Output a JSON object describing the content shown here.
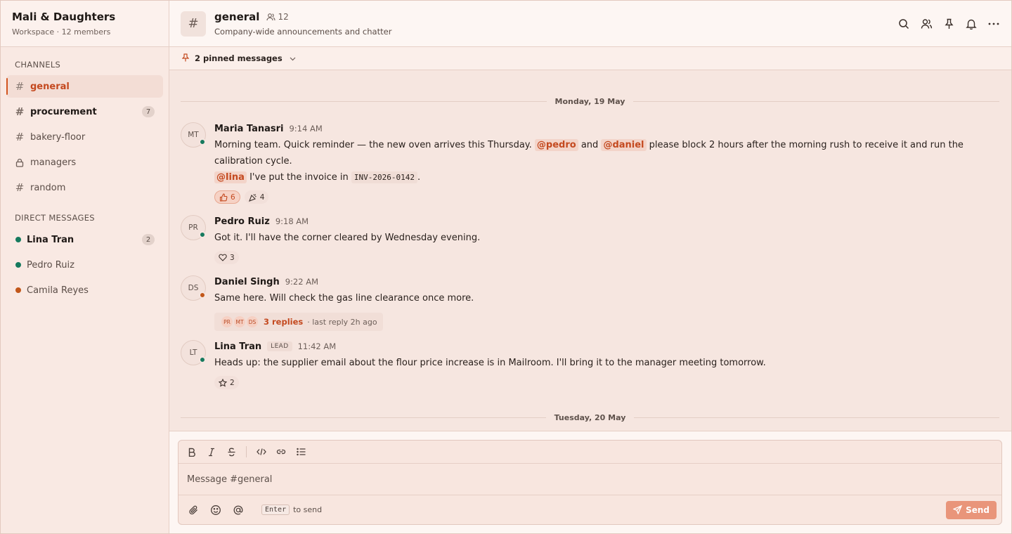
{
  "workspace": {
    "name": "Mali & Daughters",
    "subtitle": "Workspace · 12 members"
  },
  "sidebar": {
    "channels_title": "CHANNELS",
    "channels": [
      {
        "name": "general",
        "badge": ""
      },
      {
        "name": "procurement",
        "badge": "7"
      },
      {
        "name": "bakery-floor",
        "badge": ""
      },
      {
        "name": "managers",
        "badge": ""
      },
      {
        "name": "random",
        "badge": ""
      }
    ],
    "dms_title": "DIRECT MESSAGES",
    "dms": [
      {
        "name": "Lina Tran",
        "badge": "2",
        "status_color": "#167a5e"
      },
      {
        "name": "Pedro Ruiz",
        "badge": "",
        "status_color": "#167a5e"
      },
      {
        "name": "Camila Reyes",
        "badge": "",
        "status_color": "#c2571a"
      }
    ]
  },
  "header": {
    "channel_icon": "#",
    "title": "general",
    "member_count": "12",
    "description": "Company-wide announcements and chatter"
  },
  "pinned": {
    "label": "2 pinned messages"
  },
  "days": [
    {
      "label": "Monday, 19 May"
    },
    {
      "label": "Tuesday, 20 May"
    }
  ],
  "messages": [
    {
      "initials": "MT",
      "author": "Maria Tanasri",
      "time": "9:14 AM",
      "status_color": "#167a5e",
      "text": {
        "p1": "Morning team. Quick reminder — the new oven arrives this Thursday.",
        "m1": "@pedro",
        "p2": "and",
        "m2": "@daniel",
        "p3": "please block 2 hours after the morning rush to receive it and run the calibration cycle.",
        "m3": "@lina",
        "p4": "I've put the invoice in",
        "code": "INV-2026-0142",
        "p5": "."
      },
      "reactions": [
        {
          "emoji": "thumbs-up",
          "count": "6"
        },
        {
          "emoji": "party",
          "count": "4"
        }
      ]
    },
    {
      "initials": "PR",
      "author": "Pedro Ruiz",
      "time": "9:18 AM",
      "status_color": "#167a5e",
      "text": "Got it. I'll have the corner cleared by Wednesday evening.",
      "reactions": [
        {
          "emoji": "heart",
          "count": "3"
        }
      ]
    },
    {
      "initials": "DS",
      "author": "Daniel Singh",
      "time": "9:22 AM",
      "status_color": "#c2571a",
      "text": "Same here. Will check the gas line clearance once more.",
      "thread": {
        "avatars": [
          "PR",
          "MT",
          "DS"
        ],
        "count": "3 replies",
        "last": "· last reply 2h ago"
      }
    },
    {
      "initials": "LT",
      "author": "Lina Tran",
      "role": "LEAD",
      "time": "11:42 AM",
      "status_color": "#167a5e",
      "text": "Heads up: the supplier email about the flour price increase is in Mailroom. I'll bring it to the manager meeting tomorrow.",
      "reactions": [
        {
          "emoji": "star",
          "count": "2"
        }
      ]
    }
  ],
  "composer": {
    "placeholder": "Message #general",
    "hint_key": "Enter",
    "hint_text": "to send",
    "send_label": "Send"
  },
  "colors": {
    "accent": "#c4491f",
    "online": "#167a5e",
    "away": "#c2571a",
    "send_button": "#e9957a"
  }
}
